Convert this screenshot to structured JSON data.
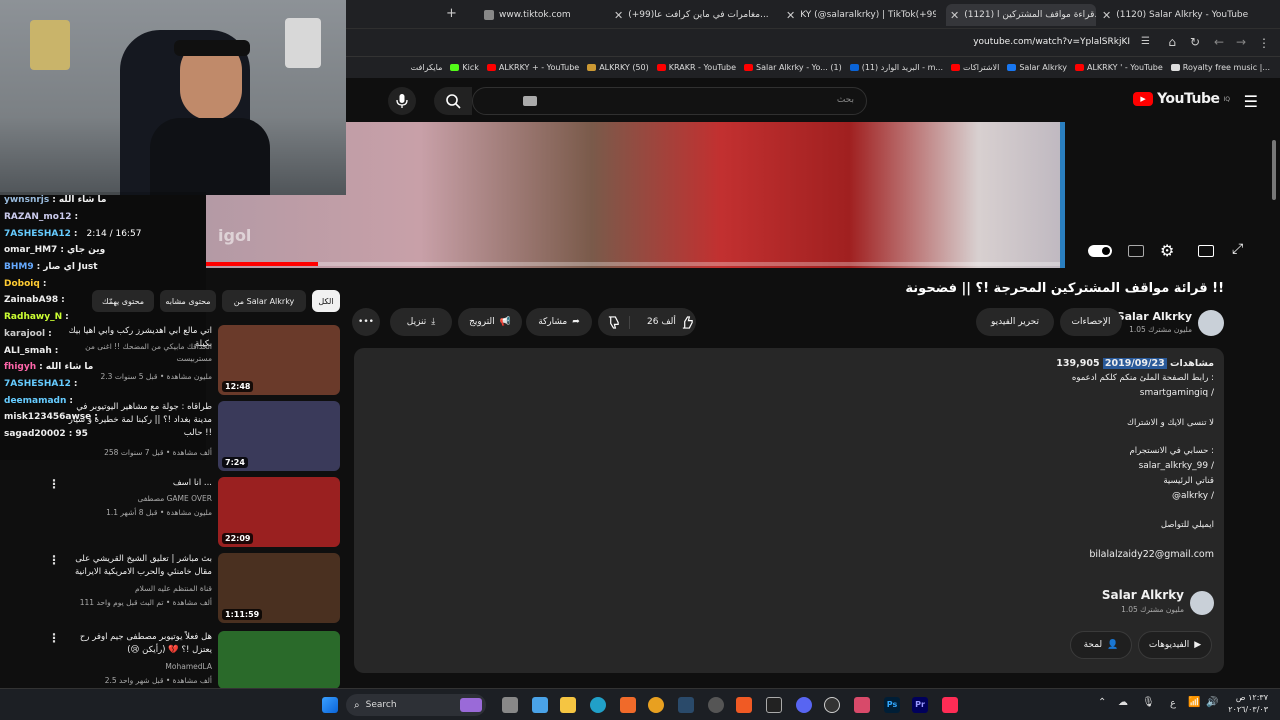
{
  "browser": {
    "tabs": [
      {
        "label": "www.tiktok.com",
        "active": false
      },
      {
        "label": "(+99)مغامرات في ماين كرافت عا...",
        "active": false
      },
      {
        "label": "KY (@salaralkrky) | TikTok(+99)",
        "active": false
      },
      {
        "label": "(1121) قراءة مواقف المشتركين ا...",
        "active": true
      },
      {
        "label": "(1120) Salar Alkrky - YouTube",
        "active": false
      }
    ],
    "url": "youtube.com/watch?v=YplalSRkjKI",
    "bookmarks": [
      "Royalty free music |...",
      "ALKRKY ' - YouTube",
      "Salar Alkrky",
      "الاشتراكات",
      "البريد الوارد (11) - m...",
      "Salar Alkrky - Yo... (1)",
      "KRAKR - YouTube",
      "ALKRKY (50)",
      "ALKRKY + - YouTube",
      "Kick",
      "مايكرافت"
    ]
  },
  "youtube": {
    "logo": "YouTube",
    "logo_sup": "IQ",
    "search_placeholder": "بحث"
  },
  "player": {
    "time": "2:14 / 16:57",
    "watermark": "igol"
  },
  "video": {
    "title": "قرائة مواقف المشتركين المحرجة !؟ || فضحونة !!",
    "channel": "Salar Alkrky",
    "subs": "1.05 مليون مشترك",
    "subscribed_label": "الإحصاءات",
    "edit_label": "تحرير الفيديو",
    "likes": "26 ألف",
    "share_label": "مشاركة",
    "promote_label": "الترويج",
    "download_label": "تنزيل"
  },
  "description": {
    "views": "139,905 مشاهدات",
    "date": "2019/09/23",
    "lines": [
      "رابط الصفحة الملئ منكم كلكم ادعموه :",
      "smartgamingiq /",
      "لا تنسى الايك و الاشتراك",
      "حسابي في الانستجرام :",
      "salar_alkrky_99 /",
      "قناتي الرئيسية",
      "@alkrky /",
      "ايميلي للتواصل",
      "bilalalzaidy22@gmail.com"
    ],
    "channel_card_name": "Salar Alkrky",
    "channel_card_subs": "1.05 مليون مشترك",
    "videos_btn": "الفيديوهات",
    "about_btn": "لمحة"
  },
  "sidebar": {
    "chips": [
      "الكل",
      "من Salar Alkrky",
      "محتوى مشابه",
      "محتوى يهمّك"
    ],
    "videos": [
      {
        "title": "اتي مالع ابي اهديشرز ركب وابي اهيا بيك بكيلة",
        "meta1": "الحداقك مابيكي من المضحك !! اغنى من مستربيست",
        "meta2": "2.3 مليون مشاهدة • قبل 5 سنوات",
        "dur": "12:48",
        "color": "#6a3a2a"
      },
      {
        "title": "طراقاه : جولة مع مشاهير اليوتيوبر في مدينة بغداد !؟ || ركبنا لمة خطيرة و سيار حالب !!",
        "meta1": "",
        "meta2": "258 ألف مشاهدة • قبل 7 سنوات",
        "dur": "7:24",
        "color": "#3a3a5a"
      },
      {
        "title": "انا اسف ...",
        "meta1": "مصطفى GAME OVER",
        "meta2": "1.1 مليون مشاهدة • قبل 8 أشهر",
        "dur": "22:09",
        "color": "#9a2020"
      },
      {
        "title": "بث مباشر | تعليق الشيخ القريشي على مقال خامنئي والحرب الامريكية الايرانية",
        "meta1": "قناة المنتظم عليه السلام",
        "meta2": "111 ألف مشاهدة • تم البث قبل يوم واحد",
        "dur": "1:11:59",
        "color": "#4a3020"
      },
      {
        "title": "هل فعلاً يوتيوبر مصطفى جيم اوفر رح يعتزل !؟ 💔 (رأيكن 😢)",
        "meta1": "MohamedLA",
        "meta2": "2.5 ألف مشاهدة • قبل شهر واحد",
        "dur": "",
        "color": "#2a6a2a"
      }
    ]
  },
  "chat": [
    {
      "user": "ywnsnrjs",
      "msg": "ما شاء الله",
      "color": "#9bd"
    },
    {
      "user": "RAZAN_mo12",
      "msg": "",
      "color": "#cce"
    },
    {
      "user": "7ASHESHA12",
      "msg": "",
      "color": "#6cf"
    },
    {
      "user": "omar_HM7",
      "msg": "وين جاي",
      "color": "#eee"
    },
    {
      "user": "BHM9",
      "msg": "اي صار Just",
      "color": "#6af"
    },
    {
      "user": "Doboiq",
      "msg": "",
      "color": "#fc3"
    },
    {
      "user": "ZainabA98",
      "msg": "",
      "color": "#eee"
    },
    {
      "user": "Radhawy_N",
      "msg": "",
      "color": "#cf3"
    },
    {
      "user": "karajool",
      "msg": "",
      "color": "#ccc"
    },
    {
      "user": "ALI_smah",
      "msg": "",
      "color": "#eee"
    },
    {
      "user": "fhigyh",
      "msg": "ما شاء الله",
      "color": "#f6a"
    },
    {
      "user": "7ASHESHA12",
      "msg": "",
      "color": "#6cf"
    },
    {
      "user": "deemamadn",
      "msg": "",
      "color": "#6cf"
    },
    {
      "user": "misk123456awse",
      "msg": "",
      "color": "#eee"
    },
    {
      "user": "sagad20002",
      "msg": "95",
      "color": "#eee"
    }
  ],
  "taskbar": {
    "search": "Search",
    "time": "١٢:٣٧ ص",
    "date": "٢٠٢٦/٠٣/٠٣",
    "lang": "ع"
  }
}
